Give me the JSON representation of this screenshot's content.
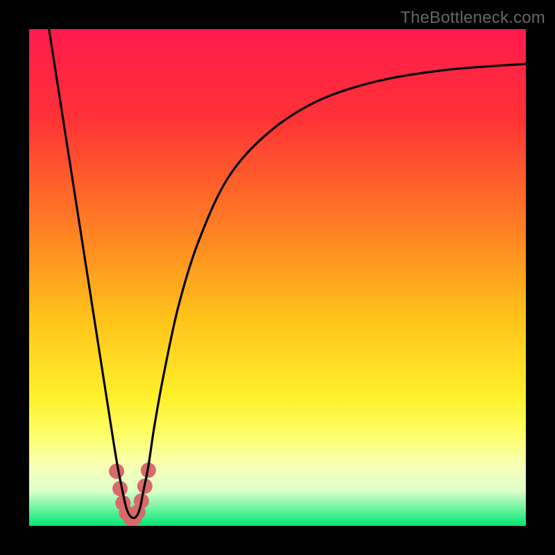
{
  "attribution": "TheBottleneck.com",
  "chart_data": {
    "type": "line",
    "title": "",
    "xlabel": "",
    "ylabel": "",
    "xlim": [
      0,
      100
    ],
    "ylim": [
      0,
      100
    ],
    "gradient_stops": [
      {
        "offset": 0,
        "color": "#ff1a4d"
      },
      {
        "offset": 18,
        "color": "#ff3236"
      },
      {
        "offset": 40,
        "color": "#ff7f23"
      },
      {
        "offset": 58,
        "color": "#ffc21a"
      },
      {
        "offset": 74,
        "color": "#fff02a"
      },
      {
        "offset": 82,
        "color": "#fdff6c"
      },
      {
        "offset": 88,
        "color": "#f8ffb5"
      },
      {
        "offset": 93,
        "color": "#dcffca"
      },
      {
        "offset": 100,
        "color": "#00e874"
      }
    ],
    "series": [
      {
        "name": "bottleneck-curve",
        "x": [
          4,
          6.5,
          9,
          11.5,
          14,
          16.5,
          17.8,
          18.8,
          19.6,
          20.5,
          21.5,
          22.3,
          23,
          24,
          25.2,
          27,
          30,
          34,
          40,
          48,
          58,
          70,
          84,
          100
        ],
        "y": [
          100,
          84,
          68,
          52,
          36,
          20,
          12,
          7,
          3.5,
          1.8,
          1.8,
          3.5,
          7,
          12,
          20,
          30,
          44,
          57,
          70,
          79,
          85.5,
          89.5,
          91.8,
          93
        ]
      }
    ],
    "marker_cluster": {
      "name": "highlight-dots",
      "color": "#d9696b",
      "radius": 11,
      "points": [
        {
          "x": 17.6,
          "y": 11.0
        },
        {
          "x": 18.3,
          "y": 7.5
        },
        {
          "x": 18.9,
          "y": 4.6
        },
        {
          "x": 19.6,
          "y": 2.6
        },
        {
          "x": 20.4,
          "y": 1.6
        },
        {
          "x": 21.2,
          "y": 1.6
        },
        {
          "x": 21.9,
          "y": 2.8
        },
        {
          "x": 22.6,
          "y": 5.0
        },
        {
          "x": 23.3,
          "y": 8.0
        },
        {
          "x": 24.0,
          "y": 11.2
        }
      ]
    }
  }
}
